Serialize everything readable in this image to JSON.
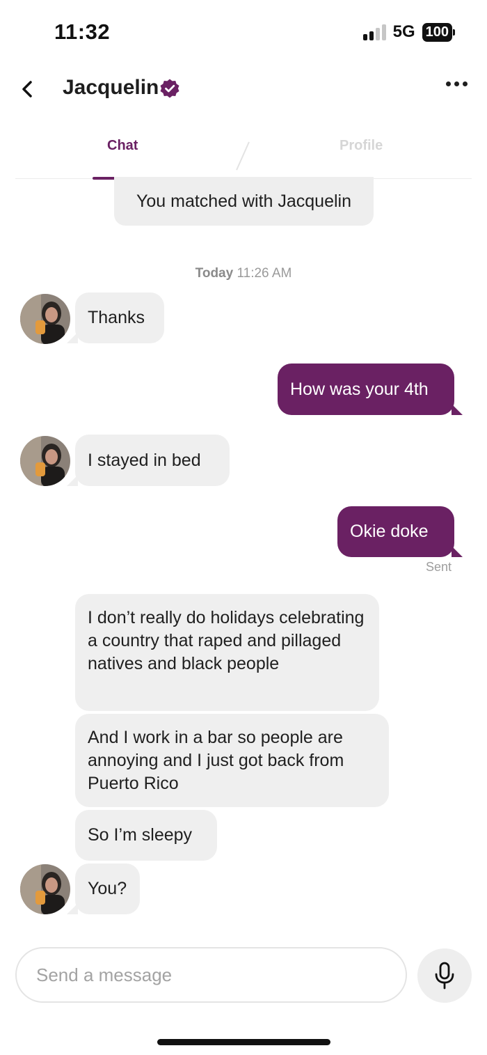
{
  "status_bar": {
    "time": "11:32",
    "network": "5G",
    "battery": "100"
  },
  "header": {
    "contact_name": "Jacquelin"
  },
  "tabs": [
    {
      "label": "Chat",
      "active": true
    },
    {
      "label": "Profile",
      "active": false
    }
  ],
  "chat": {
    "match_notice": "You matched with Jacquelin",
    "timestamp_day": "Today",
    "timestamp_time": "11:26 AM",
    "messages": [
      {
        "from": "them",
        "text": "Thanks"
      },
      {
        "from": "me",
        "text": "How was your 4th"
      },
      {
        "from": "them",
        "text": "I stayed in bed"
      },
      {
        "from": "me",
        "text": "Okie doke",
        "status": "Sent"
      },
      {
        "from": "them",
        "text": "I don’t really do holidays celebrating a country that raped and pillaged natives and black people"
      },
      {
        "from": "them",
        "text": "And I work in a bar so people are annoying and I just got back from Puerto Rico"
      },
      {
        "from": "them",
        "text": "So I’m sleepy"
      },
      {
        "from": "them",
        "text": "You?"
      }
    ]
  },
  "composer": {
    "placeholder": "Send a message"
  },
  "icons": {
    "back": "chevron-left-icon",
    "verified": "verified-badge-icon",
    "more": "ellipsis-icon",
    "mic": "microphone-icon"
  },
  "colors": {
    "accent": "#6a2163",
    "incoming_bubble": "#efefef",
    "outgoing_text": "#ffffff"
  }
}
